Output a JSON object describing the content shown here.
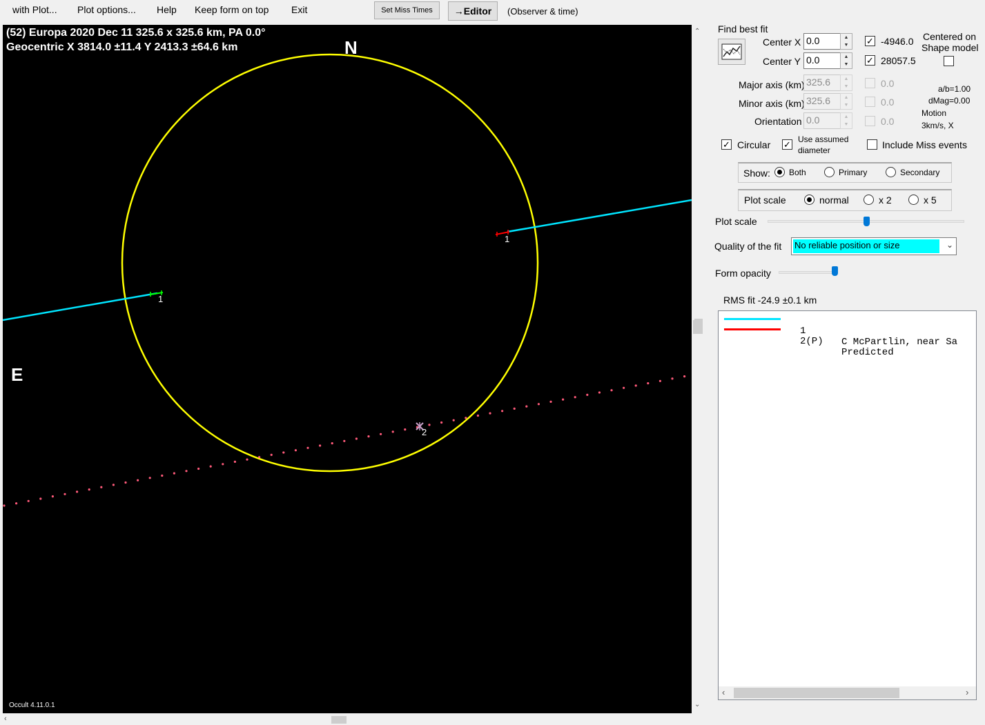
{
  "menu": {
    "with_plot": "with Plot...",
    "plot_options": "Plot options...",
    "help": "Help",
    "keep_on_top": "Keep form on top",
    "exit": "Exit",
    "set_miss_times": "Set Miss Times",
    "editor": "→Editor",
    "observer_time": "(Observer & time)"
  },
  "plot": {
    "title_line1": "(52) Europa  2020 Dec 11   325.6 x 325.6 km, PA 0.0°",
    "title_line2": "Geocentric  X  3814.0 ±11.4  Y 2413.3 ±64.6 km",
    "north_label": "N",
    "east_label": "E",
    "chord1_label_a": "1",
    "chord1_label_b": "1",
    "predicted_label": "2",
    "version": "Occult 4.11.0.1",
    "colors": {
      "background": "#000000",
      "ellipse": "#ffff00",
      "chord": "#00e5ff",
      "predicted": "#ff5a7a"
    }
  },
  "fit": {
    "find_best_fit_label": "Find best fit",
    "center_x_label": "Center X",
    "center_x_value": "0.0",
    "center_y_label": "Center Y",
    "center_y_value": "0.0",
    "x_offset_value": "-4946.0",
    "y_offset_value": "28057.5",
    "x_offset_checked": true,
    "y_offset_checked": true,
    "centered_on_label": "Centered on",
    "shape_model_label": "Shape model",
    "major_axis_label": "Major axis (km)",
    "major_axis_value": "325.6",
    "minor_axis_label": "Minor axis (km)",
    "minor_axis_value": "325.6",
    "orientation_label": "Orientation",
    "orientation_value": "0.0",
    "major_dis_value": "0.0",
    "minor_dis_value": "0.0",
    "orient_dis_value": "0.0",
    "ab_ratio": "a/b=1.00",
    "dmag": "dMag=0.00",
    "motion_label": "Motion",
    "motion_value": "3km/s, X",
    "circular_label": "Circular",
    "circular_checked": true,
    "use_assumed_label_1": "Use assumed",
    "use_assumed_label_2": "diameter",
    "use_assumed_checked": true,
    "include_miss_label": "Include Miss events",
    "include_miss_checked": false
  },
  "show": {
    "label": "Show:",
    "options": [
      "Both",
      "Primary",
      "Secondary"
    ],
    "selected": "Both"
  },
  "scale": {
    "label": "Plot scale",
    "options": [
      "normal",
      "x 2",
      "x 5"
    ],
    "selected": "normal",
    "slider_label": "Plot scale",
    "slider_level": 0.5
  },
  "quality": {
    "label": "Quality of the fit",
    "value": "No reliable position or size"
  },
  "opacity": {
    "label": "Form opacity",
    "level": 0.95
  },
  "rms": "RMS fit -24.9 ±0.1 km",
  "legend": [
    {
      "color": "#00e5ff",
      "num": "1",
      "name": "C McPartlin, near Sa"
    },
    {
      "color": "#ff0000",
      "num": "2(P)",
      "name": "Predicted"
    }
  ]
}
